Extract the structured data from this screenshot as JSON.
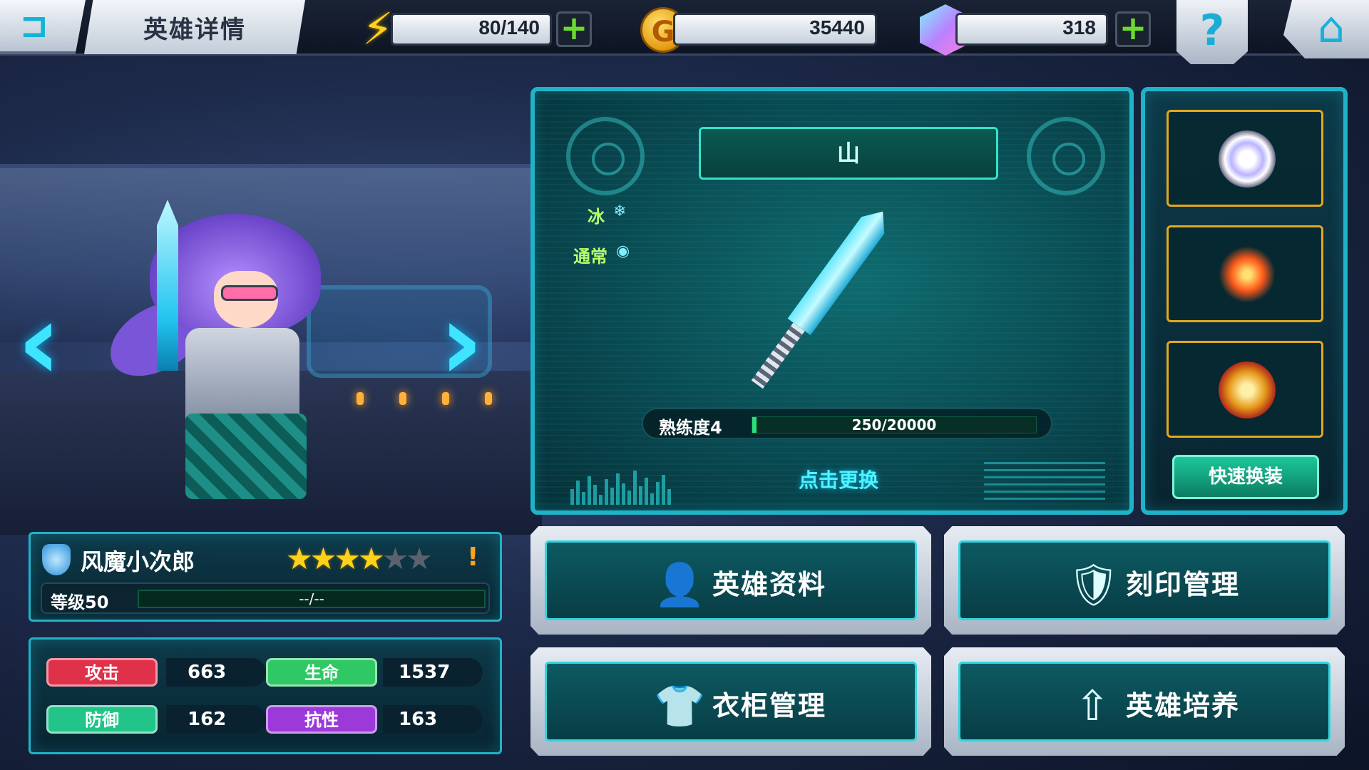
{
  "header": {
    "title": "英雄详情",
    "energy": "80/140",
    "gold": "35440",
    "gems": "318",
    "back_icon": "back-arrow-icon",
    "help_icon": "question-icon",
    "home_icon": "home-icon"
  },
  "hero": {
    "name": "风魔小次郎",
    "stars_filled": 4,
    "stars_total": 6,
    "alert": "!",
    "level_label": "等级50",
    "exp_text": "--/--"
  },
  "stats": {
    "attack_label": "攻击",
    "attack_value": "663",
    "hp_label": "生命",
    "hp_value": "1537",
    "defense_label": "防御",
    "defense_value": "162",
    "resist_label": "抗性",
    "resist_value": "163"
  },
  "weapon": {
    "name": "山",
    "element": "冰",
    "rarity": "通常",
    "mastery_label": "熟练度4",
    "mastery_text": "250/20000",
    "mastery_progress": 0.0125,
    "change_label": "点击更换"
  },
  "equipment": {
    "quick_equip_label": "快速换装",
    "slots": [
      "ring",
      "burst",
      "medal"
    ]
  },
  "menu": {
    "hero_info": "英雄资料",
    "imprint": "刻印管理",
    "wardrobe": "衣柜管理",
    "training": "英雄培养"
  },
  "colors": {
    "accent": "#1fb3c8",
    "attack": "#e0314a",
    "hp": "#2fc864",
    "defense": "#22c48a",
    "resist": "#9b3ad8",
    "star": "#ffd21a",
    "slot_border": "#e3a81a"
  }
}
